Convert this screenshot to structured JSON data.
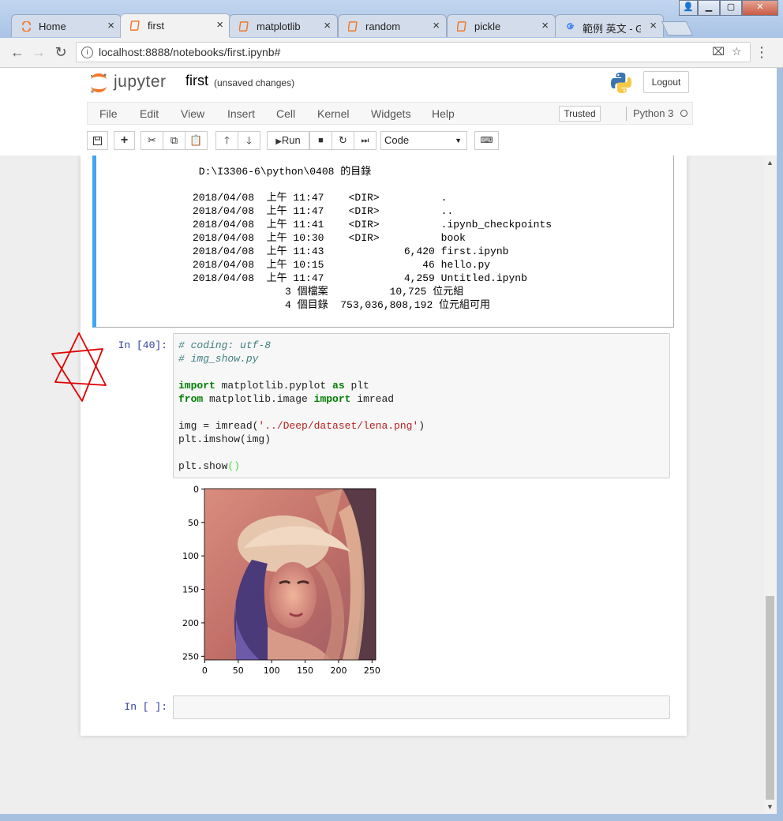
{
  "tabs": [
    {
      "label": "Home",
      "icon": "jupyter-icon"
    },
    {
      "label": "first",
      "icon": "notebook-icon",
      "active": true
    },
    {
      "label": "matplotlib",
      "icon": "notebook-icon"
    },
    {
      "label": "random",
      "icon": "notebook-icon"
    },
    {
      "label": "pickle",
      "icon": "notebook-icon"
    },
    {
      "label": "範例 英文 - Go",
      "icon": "google-icon"
    }
  ],
  "address": {
    "url": "localhost:8888/notebooks/first.ipynb#"
  },
  "jupyter": {
    "brand": "jupyter",
    "notebook_title": "first",
    "status": "(unsaved changes)",
    "logout_label": "Logout",
    "menu": [
      "File",
      "Edit",
      "View",
      "Insert",
      "Cell",
      "Kernel",
      "Widgets",
      "Help"
    ],
    "trusted_label": "Trusted",
    "kernel_name": "Python 3",
    "toolbar": {
      "run_label": "Run",
      "cell_type": "Code"
    }
  },
  "prev_output": {
    "lines": [
      " D:\\I3306-6\\python\\0408 的目錄",
      "",
      "2018/04/08  上午 11:47    <DIR>          .",
      "2018/04/08  上午 11:47    <DIR>          ..",
      "2018/04/08  上午 11:41    <DIR>          .ipynb_checkpoints",
      "2018/04/08  上午 10:30    <DIR>          book",
      "2018/04/08  上午 11:43             6,420 first.ipynb",
      "2018/04/08  上午 10:15                46 hello.py",
      "2018/04/08  上午 11:47             4,259 Untitled.ipynb",
      "               3 個檔案          10,725 位元組",
      "               4 個目錄  753,036,808,192 位元組可用"
    ]
  },
  "cell40": {
    "prompt": "In [40]:",
    "code": {
      "comment1": "# coding: utf-8",
      "comment2": "# img_show.py",
      "kw_import": "import",
      "mod1": " matplotlib.pyplot ",
      "kw_as": "as",
      "alias": " plt",
      "kw_from": "from",
      "mod2": " matplotlib.image ",
      "kw_import2": "import",
      "func": " imread",
      "line_img_a": "img = imread(",
      "line_img_str": "'../Deep/dataset/lena.png'",
      "line_img_b": ")",
      "line_imshow": "plt.imshow(img)",
      "line_show_a": "plt.show",
      "line_show_b": "()"
    },
    "plot": {
      "y_ticks": [
        "0",
        "50",
        "100",
        "150",
        "200",
        "250"
      ],
      "x_ticks": [
        "0",
        "50",
        "100",
        "150",
        "200",
        "250"
      ]
    }
  },
  "empty_cell": {
    "prompt": "In [ ]:"
  },
  "colors": {
    "selected_cell_border": "#42a5f5",
    "prompt": "#303f9f",
    "annotation": "#e00000"
  }
}
